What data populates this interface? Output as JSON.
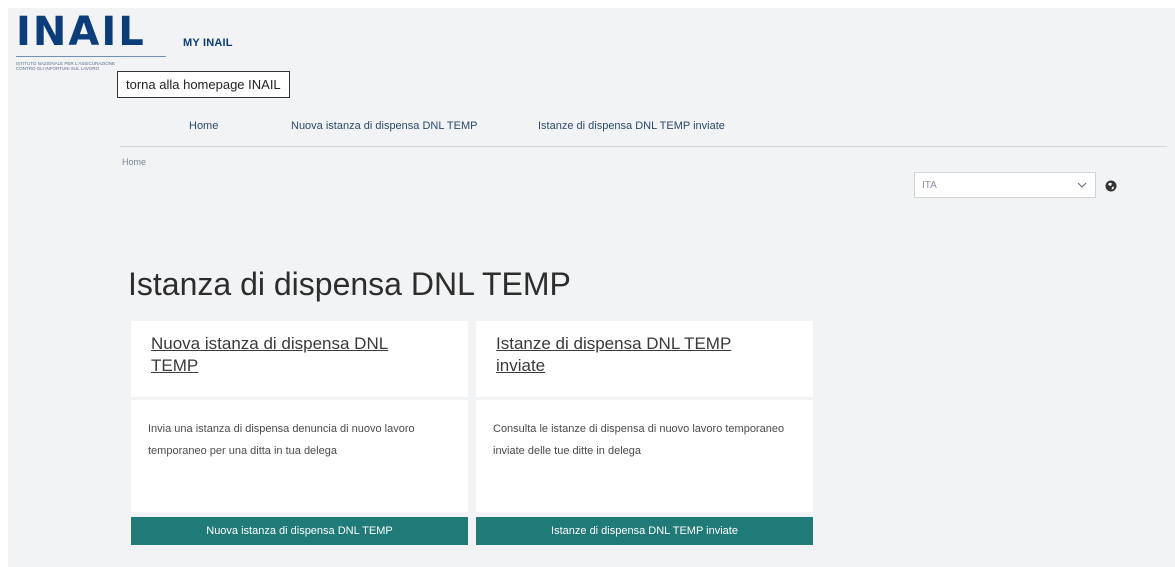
{
  "header": {
    "logo_text": "INAIL",
    "logo_tagline": "Istituto nazionale per l'assicurazione contro gli infortuni sul lavoro",
    "app_name": "MY INAIL",
    "home_tooltip": "torna alla homepage INAIL"
  },
  "nav": {
    "items": [
      {
        "label": "Home"
      },
      {
        "label": "Nuova istanza di dispensa DNL TEMP"
      },
      {
        "label": "Istanze di dispensa DNL TEMP inviate"
      }
    ]
  },
  "breadcrumb": "Home",
  "language": {
    "selected": "ITA"
  },
  "page_title": "Istanza di dispensa DNL TEMP",
  "cards": [
    {
      "title": "Nuova istanza di dispensa DNL TEMP",
      "description": "Invia una istanza di dispensa denuncia di nuovo lavoro temporaneo per una ditta in tua delega",
      "button": "Nuova istanza di dispensa DNL TEMP"
    },
    {
      "title": "Istanze di dispensa DNL TEMP inviate",
      "description": "Consulta le istanze di dispensa di nuovo lavoro temporaneo inviate delle tue ditte in delega",
      "button": "Istanze di dispensa DNL TEMP inviate"
    }
  ],
  "colors": {
    "brand_blue": "#0b3d7a",
    "button_teal": "#1f7a78",
    "background": "#f2f3f4"
  }
}
